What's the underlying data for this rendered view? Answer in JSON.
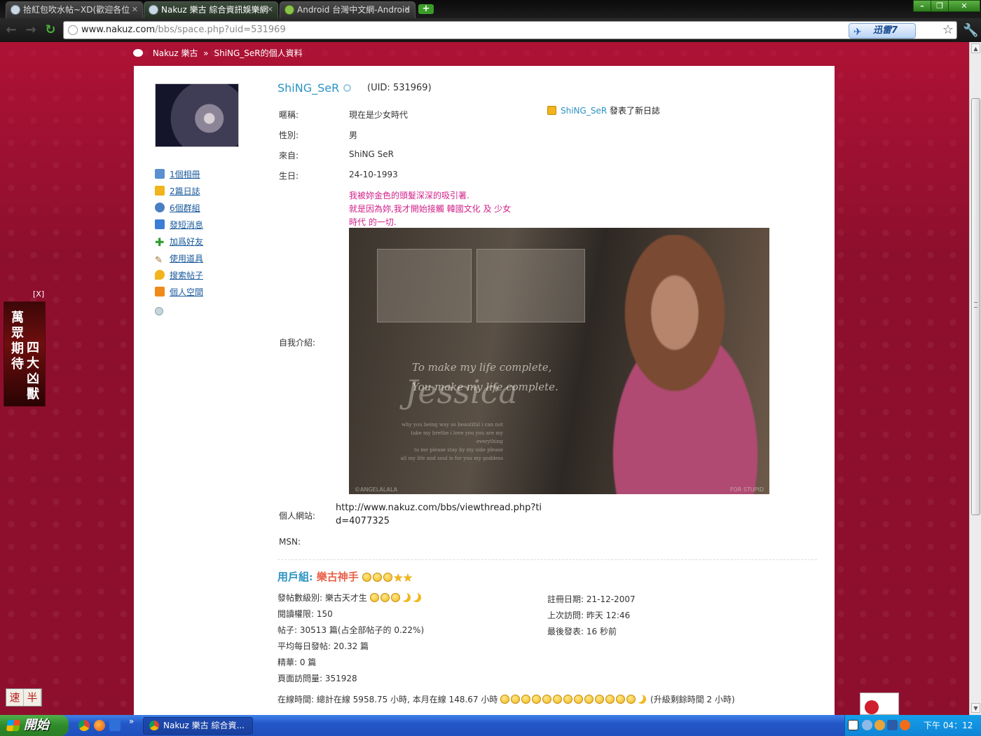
{
  "browser": {
    "tabs": [
      {
        "title": "拾紅包吹水帖~XD(歡迎各位",
        "active": false
      },
      {
        "title": "Nakuz 樂古 綜合資訊娛樂網",
        "active": true
      },
      {
        "title": "Android 台灣中文網-Android",
        "active": false
      }
    ],
    "new_tab": "+",
    "url_host": "www.nakuz.com",
    "url_path": "/bbs/space.php?uid=531969",
    "xunlei_label": "迅雷7",
    "window_controls": {
      "minimize": "–",
      "restore": "❐",
      "close": "✕"
    }
  },
  "breadcrumb": {
    "site": "Nakuz 樂古",
    "separator": "»",
    "current": "ShiNG_SeR的個人資料"
  },
  "sidebar": {
    "items": [
      {
        "label": "1個相冊",
        "icon": "album-icon",
        "color": "#5a8fd0"
      },
      {
        "label": "2篇日誌",
        "icon": "journal-icon",
        "color": "#f1b41d"
      },
      {
        "label": "6個群組",
        "icon": "group-icon",
        "color": "#4a7fc1"
      },
      {
        "label": "發短消息",
        "icon": "mail-icon",
        "color": "#3a7dd6"
      },
      {
        "label": "加爲好友",
        "icon": "add-friend-icon",
        "color": "#2e9b2e"
      },
      {
        "label": "使用道具",
        "icon": "wand-icon",
        "color": "#9a6a2a"
      },
      {
        "label": "搜索帖子",
        "icon": "search-posts-icon",
        "color": "#f1b41d"
      },
      {
        "label": "個人空間",
        "icon": "home-icon",
        "color": "#f08a1a"
      }
    ]
  },
  "profile": {
    "username": "ShiNG_SeR",
    "uid": "(UID: 531969)",
    "fields": {
      "nickname_label": "暱稱:",
      "nickname": "現在是少女時代",
      "gender_label": "性別:",
      "gender": "男",
      "from_label": "來自:",
      "from": "ShiNG SeR",
      "birthday_label": "生日:",
      "birthday": "24-10-1993",
      "intro_label": "自我介紹:",
      "intro_lines": [
        "我被妳金色的頭髮深深的吸引著.",
        "就是因為妳,我才開始接觸 韓國文化 及 少女",
        "時代 的一切."
      ],
      "website_label": "個人網站:",
      "website": "http://www.nakuz.com/bbs/viewthread.php?tid=4077325",
      "msn_label": "MSN:",
      "msn": ""
    },
    "intro_image": {
      "line1": "To make my life complete,",
      "line2": "You make my life complete.",
      "big": "Jessica",
      "small_lines": [
        "why you being way so beautiful i can not",
        "take my brethe i love you you are my everything",
        "to me please stay by my side please",
        "all my life and soul is for you my goddess"
      ],
      "watermark_left": "©ANGELALALA",
      "watermark_right": "FOR STUPID"
    },
    "feed": {
      "who": "ShiNG_SeR",
      "action": "發表了新日誌"
    }
  },
  "stats": {
    "group_label": "用戶組:",
    "group_name": "樂古神手",
    "post_level_label": "發帖數級別: 樂古天才生",
    "read_permission": "閱讀權限: 150",
    "posts": "帖子: 30513 篇(占全部帖子的 0.22%)",
    "avg_daily": "平均每日發帖: 20.32 篇",
    "digest": "精華: 0 篇",
    "page_views": "頁面訪問量: 351928",
    "register_date": "註冊日期: 21-12-2007",
    "last_visit": "上次訪問: 昨天 12:46",
    "last_post": "最後發表: 16 秒前",
    "online_time": "在線時間: 總計在線 5958.75 小時, 本月在線 148.67 小時",
    "upgrade_remaining": "(升級剩餘時間 2 小時)"
  },
  "left_ad": {
    "col1": "萬眾期待",
    "col2": "四大凶獸",
    "close": "[X]"
  },
  "ime": [
    "速",
    "半"
  ],
  "taskbar": {
    "start": "開始",
    "task_title": "Nakuz 樂古 綜合資...",
    "clock": "下午 04：12",
    "overflow": "»"
  }
}
